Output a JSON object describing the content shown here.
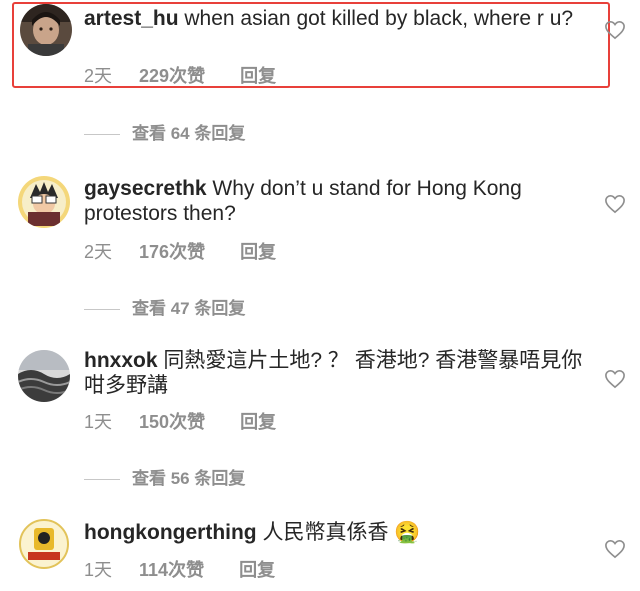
{
  "comments": [
    {
      "username": "artest_hu",
      "text": " when asian got killed by black, where r u?",
      "time": "2天",
      "likes": "229次赞",
      "reply": "回复",
      "avatar_icon": "profile-photo"
    },
    {
      "username": "gaysecrethk",
      "text": " Why don’t u stand for Hong Kong protestors then?",
      "time": "2天",
      "likes": "176次赞",
      "reply": "回复",
      "avatar_icon": "cartoon-avatar"
    },
    {
      "username": "hnxxok",
      "text": " 同熱愛這片土地? ？ 香港地? 香港警暴唔見你咁多野講",
      "time": "1天",
      "likes": "150次赞",
      "reply": "回复",
      "avatar_icon": "landscape-avatar"
    },
    {
      "username": "hongkongerthing",
      "text": " 人民幣真係香 🤮",
      "time": "1天",
      "likes": "114次赞",
      "reply": "回复",
      "avatar_icon": "logo-avatar"
    }
  ],
  "view_replies": [
    "查看 64 条回复",
    "查看 47 条回复",
    "查看 56 条回复"
  ],
  "colors": {
    "highlight_border": "#e8403a",
    "text": "#262626",
    "muted": "#8e8e8e"
  }
}
